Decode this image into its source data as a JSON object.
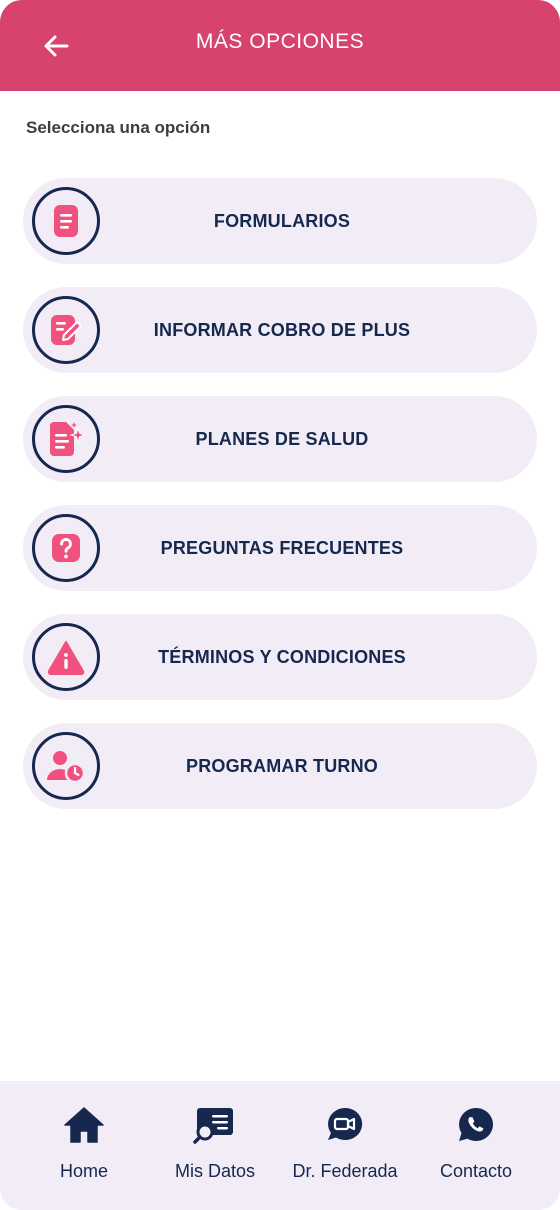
{
  "header": {
    "title": "MÁS OPCIONES",
    "back_icon": "arrow-left-icon"
  },
  "section_label": "Selecciona una opción",
  "options": [
    {
      "label": "FORMULARIOS",
      "icon": "document-icon"
    },
    {
      "label": "INFORMAR COBRO DE PLUS",
      "icon": "edit-document-icon"
    },
    {
      "label": "PLANES DE SALUD",
      "icon": "sparkle-document-icon"
    },
    {
      "label": "PREGUNTAS FRECUENTES",
      "icon": "question-icon"
    },
    {
      "label": "TÉRMINOS Y CONDICIONES",
      "icon": "warning-icon"
    },
    {
      "label": "PROGRAMAR TURNO",
      "icon": "user-clock-icon"
    }
  ],
  "bottom_nav": [
    {
      "label": "Home",
      "icon": "home-icon"
    },
    {
      "label": "Mis Datos",
      "icon": "search-list-icon"
    },
    {
      "label": "Dr. Federada",
      "icon": "video-chat-icon"
    },
    {
      "label": "Contacto",
      "icon": "whatsapp-icon"
    }
  ],
  "colors": {
    "header": "#d8436d",
    "accent_pink": "#f0517f",
    "navy": "#16284e",
    "option_bg": "#f1ecf6"
  }
}
